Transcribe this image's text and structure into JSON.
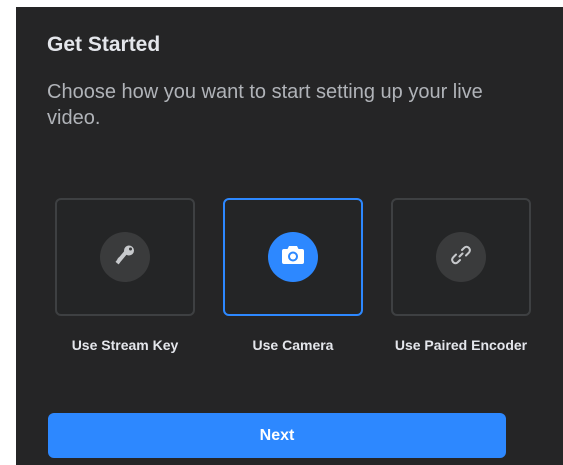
{
  "dialog": {
    "title": "Get Started",
    "subtitle": "Choose how you want to start setting up your live video."
  },
  "options": [
    {
      "label": "Use Stream Key",
      "icon": "key-icon",
      "selected": false
    },
    {
      "label": "Use Camera",
      "icon": "camera-icon",
      "selected": true
    },
    {
      "label": "Use Paired Encoder",
      "icon": "link-icon",
      "selected": false
    }
  ],
  "footer": {
    "next_label": "Next"
  },
  "colors": {
    "background": "#252526",
    "accent": "#2d88ff",
    "card_border": "#3e4042",
    "icon_bg": "#3a3b3c",
    "text_primary": "#e4e6eb",
    "text_secondary": "#b0b3b8"
  }
}
